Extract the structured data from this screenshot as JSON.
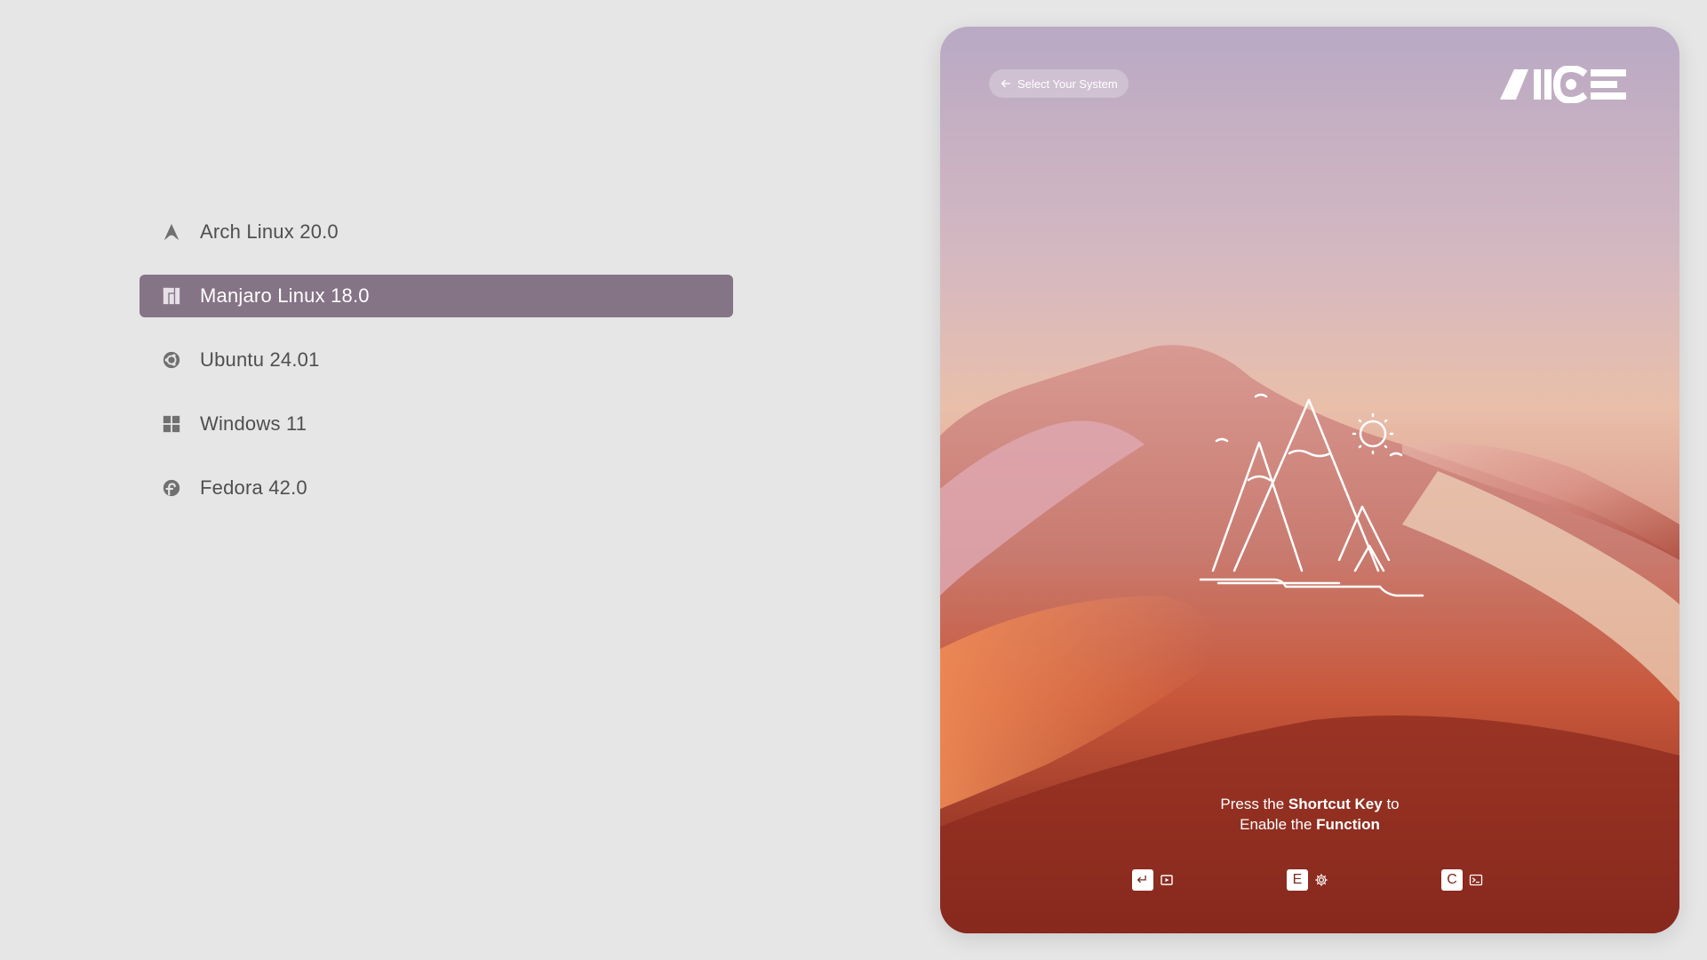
{
  "os_list": {
    "items": [
      {
        "label": "Arch Linux 20.0",
        "icon": "arch-icon",
        "selected": false
      },
      {
        "label": "Manjaro Linux 18.0",
        "icon": "manjaro-icon",
        "selected": true
      },
      {
        "label": "Ubuntu 24.01",
        "icon": "ubuntu-icon",
        "selected": false
      },
      {
        "label": "Windows 11",
        "icon": "windows-icon",
        "selected": false
      },
      {
        "label": "Fedora 42.0",
        "icon": "fedora-icon",
        "selected": false
      }
    ]
  },
  "card": {
    "back_label": "Select Your System",
    "logo_text": "NICE",
    "hint": {
      "prefix1": "Press the ",
      "bold1": "Shortcut Key",
      "suffix1": " to",
      "prefix2": "Enable the ",
      "bold2": "Function"
    },
    "shortcuts": [
      {
        "key": "↵",
        "icon": "media-icon"
      },
      {
        "key": "E",
        "icon": "gear-icon"
      },
      {
        "key": "C",
        "icon": "terminal-icon"
      }
    ]
  },
  "colors": {
    "background": "#e6e6e6",
    "selected_item": "#857386",
    "text": "#4f4f4f"
  }
}
